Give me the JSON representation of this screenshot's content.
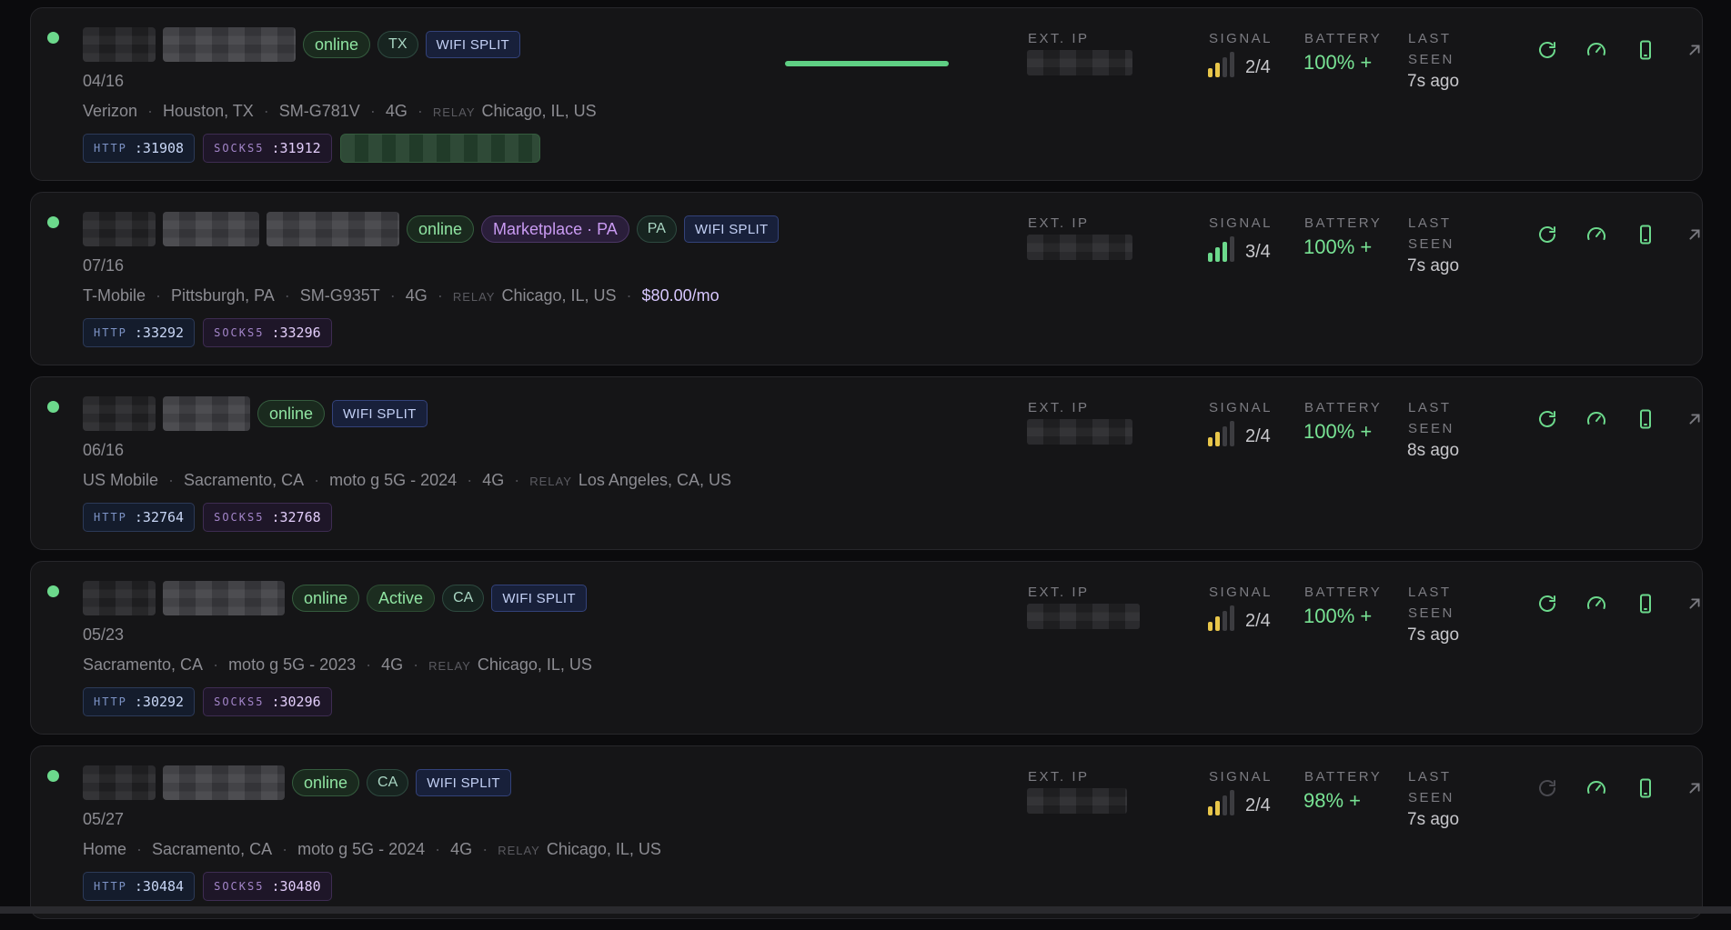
{
  "columns": {
    "ext_ip": "EXT. IP",
    "signal": "SIGNAL",
    "battery": "BATTERY",
    "last_seen_1": "LAST",
    "last_seen_2": "SEEN"
  },
  "colors": {
    "accent_green": "#6cd98c",
    "signal_yellow": "#e8c64a",
    "signal_green": "#6cd98c",
    "signal_off": "#3c3c40"
  },
  "relay_label": "RELAY",
  "port_labels": {
    "http": "HTTP",
    "socks": "SOCKS5"
  },
  "icons": {
    "refresh": "refresh-icon",
    "speed": "speedometer-icon",
    "phone": "phone-icon",
    "open": "arrow-up-right-icon"
  },
  "devices": [
    {
      "badges": [
        {
          "kind": "online",
          "text": "online"
        },
        {
          "kind": "state",
          "text": "TX"
        },
        {
          "kind": "wifi",
          "text": "WIFI SPLIT"
        }
      ],
      "date": "04/16",
      "carrier": "Verizon",
      "location": "Houston, TX",
      "model": "SM-G781V",
      "network": "4G",
      "relay": "Chicago, IL, US",
      "price": "",
      "http_port": ":31908",
      "socks_port": ":31912",
      "has_progress": true,
      "progress": 1.0,
      "signal_value": "2/4",
      "signal_level": 2,
      "battery": "100% +",
      "last_seen": "7s ago",
      "refresh_enabled": true
    },
    {
      "badges": [
        {
          "kind": "online",
          "text": "online"
        },
        {
          "kind": "market",
          "text": "Marketplace · PA"
        },
        {
          "kind": "state",
          "text": "PA"
        },
        {
          "kind": "wifi",
          "text": "WIFI SPLIT"
        }
      ],
      "date": "07/16",
      "carrier": "T-Mobile",
      "location": "Pittsburgh, PA",
      "model": "SM-G935T",
      "network": "4G",
      "relay": "Chicago, IL, US",
      "price": "$80.00/mo",
      "http_port": ":33292",
      "socks_port": ":33296",
      "has_progress": false,
      "signal_value": "3/4",
      "signal_level": 3,
      "battery": "100% +",
      "last_seen": "7s ago",
      "refresh_enabled": true
    },
    {
      "badges": [
        {
          "kind": "online",
          "text": "online"
        },
        {
          "kind": "wifi",
          "text": "WIFI SPLIT"
        }
      ],
      "date": "06/16",
      "carrier": "US Mobile",
      "location": "Sacramento, CA",
      "model": "moto g 5G - 2024",
      "network": "4G",
      "relay": "Los Angeles, CA, US",
      "price": "",
      "http_port": ":32764",
      "socks_port": ":32768",
      "has_progress": false,
      "signal_value": "2/4",
      "signal_level": 2,
      "battery": "100% +",
      "last_seen": "8s ago",
      "refresh_enabled": true
    },
    {
      "badges": [
        {
          "kind": "online",
          "text": "online"
        },
        {
          "kind": "active",
          "text": "Active"
        },
        {
          "kind": "state",
          "text": "CA"
        },
        {
          "kind": "wifi",
          "text": "WIFI SPLIT"
        }
      ],
      "date": "05/23",
      "carrier": "",
      "location": "Sacramento, CA",
      "model": "moto g 5G - 2023",
      "network": "4G",
      "relay": "Chicago, IL, US",
      "price": "",
      "http_port": ":30292",
      "socks_port": ":30296",
      "has_progress": false,
      "signal_value": "2/4",
      "signal_level": 2,
      "battery": "100% +",
      "last_seen": "7s ago",
      "refresh_enabled": true
    },
    {
      "badges": [
        {
          "kind": "online",
          "text": "online"
        },
        {
          "kind": "state",
          "text": "CA"
        },
        {
          "kind": "wifi",
          "text": "WIFI SPLIT"
        }
      ],
      "date": "05/27",
      "carrier": "Home",
      "location": "Sacramento, CA",
      "model": "moto g 5G - 2024",
      "network": "4G",
      "relay": "Chicago, IL, US",
      "price": "",
      "http_port": ":30484",
      "socks_port": ":30480",
      "has_progress": false,
      "signal_value": "2/4",
      "signal_level": 2,
      "battery": "98% +",
      "last_seen": "7s ago",
      "refresh_enabled": false
    }
  ]
}
